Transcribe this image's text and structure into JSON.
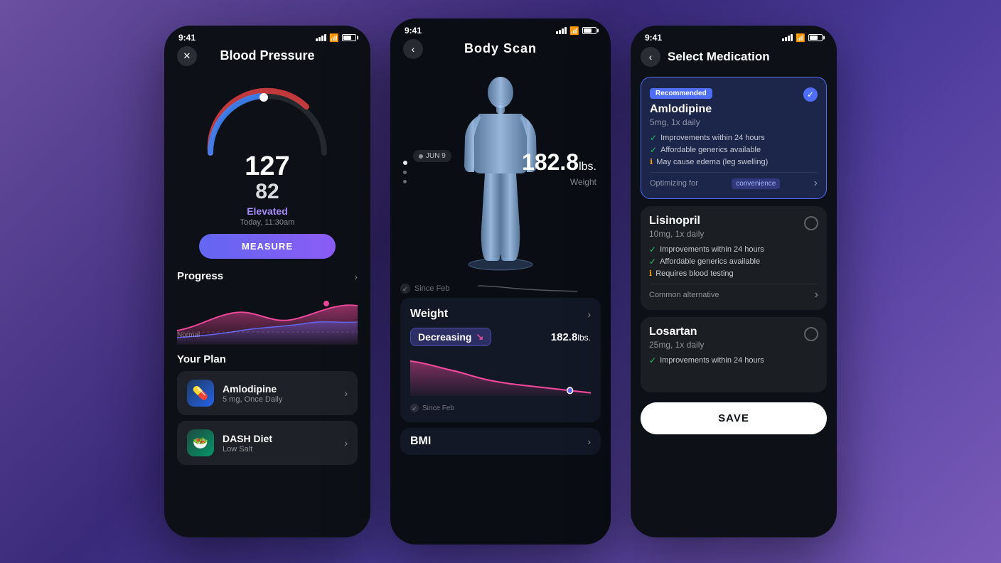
{
  "phone1": {
    "status_time": "9:41",
    "title": "Blood Pressure",
    "systolic": "127",
    "diastolic": "82",
    "status": "Elevated",
    "time": "Today, 11:30am",
    "measure_btn": "MEASURE",
    "progress_title": "Progress",
    "normal_label": "Normal",
    "plan_title": "Your Plan",
    "plan_items": [
      {
        "name": "Amlodipine",
        "desc": "5 mg, Once Daily",
        "icon": "💊"
      },
      {
        "name": "DASH Diet",
        "desc": "Low Salt",
        "icon": "🥗"
      }
    ]
  },
  "phone2": {
    "status_time": "9:41",
    "title": "Body Scan",
    "weight_value": "182.8",
    "weight_unit": "lbs.",
    "weight_label": "Weight",
    "date_label": "JUN 9",
    "since_label": "Since Feb",
    "metrics": [
      {
        "title": "Weight",
        "status": "Decreasing",
        "value": "182.8",
        "unit": "lbs.",
        "since": "Since Feb"
      },
      {
        "title": "BMI",
        "chevron": "›"
      }
    ]
  },
  "phone3": {
    "status_time": "9:41",
    "title": "Select Medication",
    "medications": [
      {
        "name": "Amlodipine",
        "dosage": "5mg, 1x daily",
        "recommended": "Recommended",
        "selected": true,
        "features": [
          {
            "type": "check",
            "text": "Improvements within 24 hours"
          },
          {
            "type": "check",
            "text": "Affordable generics available"
          },
          {
            "type": "warn",
            "text": "May cause edema (leg swelling)"
          }
        ],
        "footer_label": "Optimizing for",
        "footer_tag": "convenience"
      },
      {
        "name": "Lisinopril",
        "dosage": "10mg, 1x daily",
        "selected": false,
        "features": [
          {
            "type": "check",
            "text": "Improvements within 24 hours"
          },
          {
            "type": "check",
            "text": "Affordable generics available"
          },
          {
            "type": "warn",
            "text": "Requires blood testing"
          }
        ],
        "footer_label": "Common alternative",
        "footer_tag": ""
      },
      {
        "name": "Losartan",
        "dosage": "25mg, 1x daily",
        "selected": false,
        "features": [
          {
            "type": "check",
            "text": "Improvements within 24 hours"
          }
        ],
        "footer_label": "",
        "footer_tag": ""
      }
    ],
    "save_btn": "SAVE"
  }
}
